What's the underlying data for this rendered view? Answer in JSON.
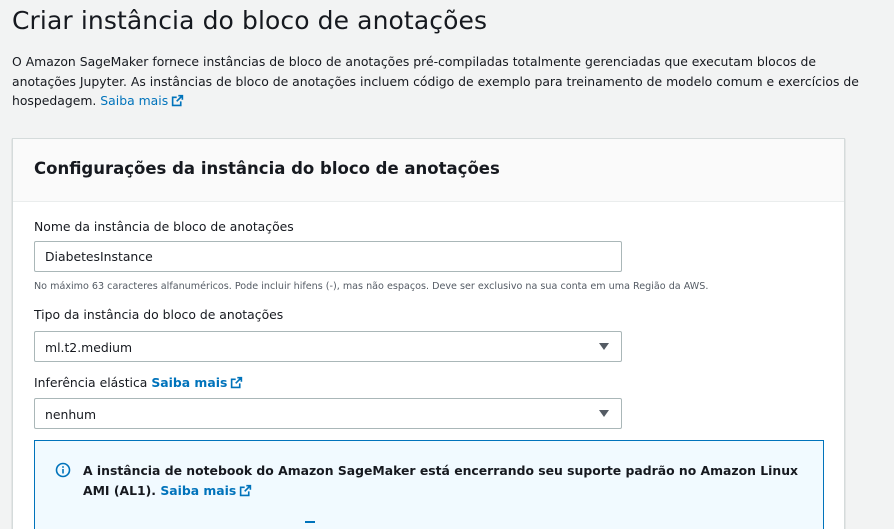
{
  "page": {
    "title": "Criar instância do bloco de anotações",
    "description": "O Amazon SageMaker fornece instâncias de bloco de anotações pré-compiladas totalmente gerenciadas que executam blocos de anotações Jupyter. As instâncias de bloco de anotações incluem código de exemplo para treinamento de modelo comum e exercícios de hospedagem.",
    "learn_more": "Saiba mais"
  },
  "settings": {
    "title": "Configurações da instância do bloco de anotações",
    "name_label": "Nome da instância de bloco de anotações",
    "name_value": "DiabetesInstance",
    "name_hint": "No máximo 63 caracteres alfanuméricos. Pode incluir hifens (-), mas não espaços. Deve ser exclusivo na sua conta em uma Região da AWS.",
    "type_label": "Tipo da instância do bloco de anotações",
    "type_value": "ml.t2.medium",
    "elastic_label": "Inferência elástica",
    "elastic_learn_more": "Saiba mais",
    "elastic_value": "nenhum"
  },
  "alert": {
    "text": "A instância de notebook do Amazon SageMaker está encerrando seu suporte padrão no Amazon Linux AMI (AL1).",
    "learn_more": "Saiba mais",
    "icon": "info-icon"
  },
  "colors": {
    "link": "#0073bb",
    "alert_bg": "#f1faff",
    "alert_border": "#0073bb"
  }
}
